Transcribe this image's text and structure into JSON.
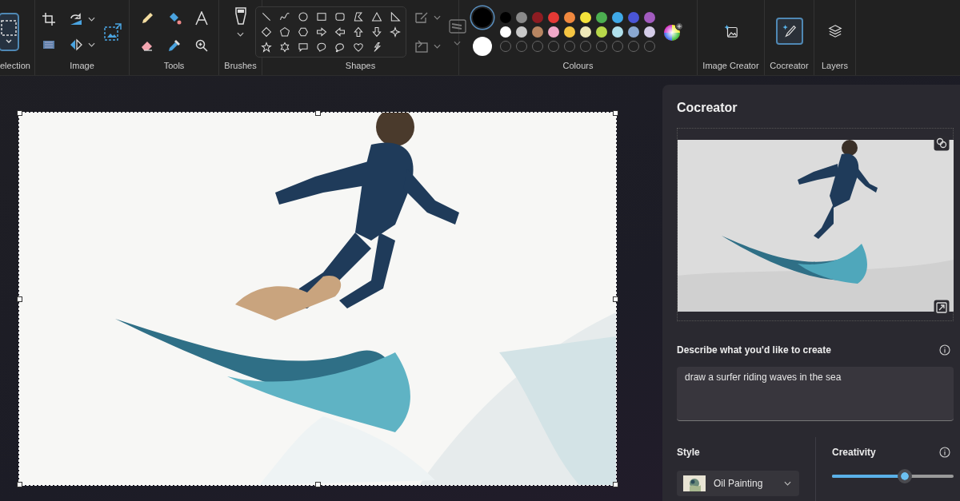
{
  "ribbon": {
    "groups": [
      {
        "kind": "selection",
        "label": "election",
        "selected": true
      },
      {
        "label": "Image"
      },
      {
        "kind": "tools",
        "label": "Tools"
      },
      {
        "kind": "brushes",
        "label": "Brushes"
      },
      {
        "kind": "shapes",
        "label": "Shapes"
      },
      {
        "kind": "colours",
        "label": "Colours",
        "current": [
          {
            "color": "#000000",
            "selected": true
          },
          {
            "color": "#ffffff",
            "selected": false
          }
        ],
        "palette": [
          {
            "kind": "swatch",
            "color": "#000000"
          },
          {
            "kind": "swatch",
            "color": "#8a8a8a"
          },
          {
            "kind": "swatch",
            "color": "#8e1c22"
          },
          {
            "kind": "swatch",
            "color": "#e53935"
          },
          {
            "kind": "swatch",
            "color": "#f0883e"
          },
          {
            "kind": "swatch",
            "color": "#f5e33a"
          },
          {
            "kind": "swatch",
            "color": "#4caf50"
          },
          {
            "kind": "swatch",
            "color": "#3fa9e8"
          },
          {
            "kind": "swatch",
            "color": "#4a55d6"
          },
          {
            "kind": "swatch",
            "color": "#a25bbf"
          },
          {
            "kind": "swatch",
            "color": "#ffffff"
          },
          {
            "kind": "swatch",
            "color": "#c8c8c8"
          },
          {
            "kind": "swatch",
            "color": "#b88662"
          },
          {
            "kind": "swatch",
            "color": "#f0a8c8"
          },
          {
            "kind": "swatch",
            "color": "#f5c542"
          },
          {
            "kind": "swatch",
            "color": "#eee8b8"
          },
          {
            "kind": "swatch",
            "color": "#b8d84a"
          },
          {
            "kind": "swatch",
            "color": "#b0e0ec"
          },
          {
            "kind": "swatch",
            "color": "#8aa8d0"
          },
          {
            "kind": "swatch",
            "color": "#d4cce8"
          },
          {
            "kind": "empty"
          },
          {
            "kind": "empty"
          },
          {
            "kind": "empty"
          },
          {
            "kind": "empty"
          },
          {
            "kind": "empty"
          },
          {
            "kind": "empty"
          },
          {
            "kind": "empty"
          },
          {
            "kind": "empty"
          },
          {
            "kind": "empty"
          },
          {
            "kind": "empty"
          }
        ]
      },
      {
        "kind": "image-creator",
        "label": "Image Creator",
        "selected": false
      },
      {
        "kind": "cocreator",
        "label": "Cocreator",
        "selected": true
      },
      {
        "kind": "layers",
        "label": "Layers",
        "selected": false
      }
    ]
  },
  "cocreator_panel": {
    "title": "Cocreator",
    "prompt": {
      "label": "Describe what you'd like to create",
      "value": "draw a surfer riding waves in the sea"
    },
    "style": {
      "label": "Style",
      "value": "Oil Painting"
    },
    "creativity": {
      "label": "Creativity",
      "level": 0.6
    }
  }
}
